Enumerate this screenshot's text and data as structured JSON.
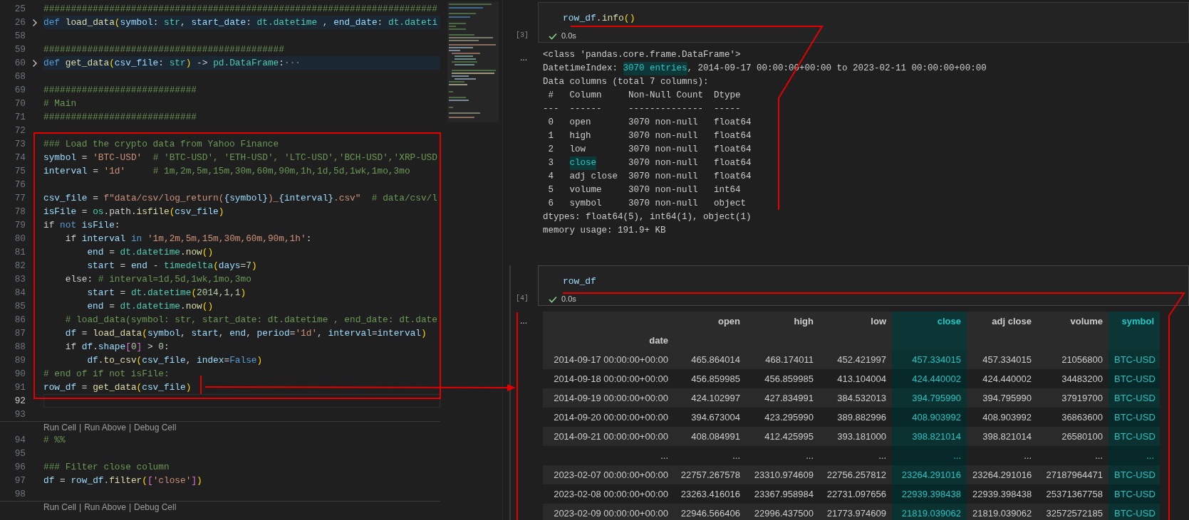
{
  "editor": {
    "lines": [
      {
        "kind": "line",
        "number": "25",
        "segments": [
          {
            "kind": "comment",
            "text": "########################################################################"
          }
        ]
      },
      {
        "kind": "folded",
        "number": "26",
        "segments": [
          {
            "kind": "kw",
            "text": "def "
          },
          {
            "kind": "fn",
            "text": "load_data"
          },
          {
            "kind": "paren",
            "text": "("
          },
          {
            "kind": "var",
            "text": "symbol"
          },
          {
            "kind": "plain",
            "text": ": "
          },
          {
            "kind": "cls",
            "text": "str"
          },
          {
            "kind": "plain",
            "text": ", "
          },
          {
            "kind": "var",
            "text": "start_date"
          },
          {
            "kind": "plain",
            "text": ": "
          },
          {
            "kind": "cls",
            "text": "dt.datetime"
          },
          {
            "kind": "plain",
            "text": " , "
          },
          {
            "kind": "var",
            "text": "end_date"
          },
          {
            "kind": "plain",
            "text": ": "
          },
          {
            "kind": "cls",
            "text": "dt.dateti"
          }
        ]
      },
      {
        "kind": "line",
        "number": "58"
      },
      {
        "kind": "line",
        "number": "59",
        "segments": [
          {
            "kind": "comment",
            "text": "############################################"
          }
        ]
      },
      {
        "kind": "folded",
        "number": "60",
        "segments": [
          {
            "kind": "kw",
            "text": "def "
          },
          {
            "kind": "fn",
            "text": "get_data"
          },
          {
            "kind": "paren",
            "text": "("
          },
          {
            "kind": "var",
            "text": "csv_file"
          },
          {
            "kind": "plain",
            "text": ": "
          },
          {
            "kind": "cls",
            "text": "str"
          },
          {
            "kind": "paren",
            "text": ")"
          },
          {
            "kind": "plain",
            "text": " -> "
          },
          {
            "kind": "cls",
            "text": "pd.DataFrame"
          },
          {
            "kind": "plain",
            "text": ":"
          },
          {
            "kind": "fold",
            "text": "···"
          }
        ]
      },
      {
        "kind": "line",
        "number": "68"
      },
      {
        "kind": "line",
        "number": "69",
        "segments": [
          {
            "kind": "comment",
            "text": "############################"
          }
        ]
      },
      {
        "kind": "line",
        "number": "70",
        "segments": [
          {
            "kind": "comment",
            "text": "# Main"
          }
        ]
      },
      {
        "kind": "line",
        "number": "71",
        "segments": [
          {
            "kind": "comment",
            "text": "############################"
          }
        ]
      },
      {
        "kind": "line",
        "number": "72"
      },
      {
        "kind": "line",
        "number": "73",
        "segments": [
          {
            "kind": "comment",
            "text": "### Load the crypto data from Yahoo Finance"
          }
        ]
      },
      {
        "kind": "line",
        "number": "74",
        "segments": [
          {
            "kind": "var",
            "text": "symbol"
          },
          {
            "kind": "plain",
            "text": " = "
          },
          {
            "kind": "str",
            "text": "'BTC-USD'"
          },
          {
            "kind": "comment",
            "text": "  # 'BTC-USD', 'ETH-USD', 'LTC-USD','BCH-USD','XRP-USD"
          }
        ]
      },
      {
        "kind": "line",
        "number": "75",
        "segments": [
          {
            "kind": "var",
            "text": "interval"
          },
          {
            "kind": "plain",
            "text": " = "
          },
          {
            "kind": "str",
            "text": "'1d'"
          },
          {
            "kind": "comment",
            "text": "     # 1m,2m,5m,15m,30m,60m,90m,1h,1d,5d,1wk,1mo,3mo"
          }
        ]
      },
      {
        "kind": "line",
        "number": "76"
      },
      {
        "kind": "line",
        "number": "77",
        "segments": [
          {
            "kind": "var",
            "text": "csv_file"
          },
          {
            "kind": "plain",
            "text": " = "
          },
          {
            "kind": "str",
            "text": "f\"data/csv/log_return("
          },
          {
            "kind": "var",
            "text": "{symbol}"
          },
          {
            "kind": "str",
            "text": ")_"
          },
          {
            "kind": "var",
            "text": "{interval}"
          },
          {
            "kind": "str",
            "text": ".csv\""
          },
          {
            "kind": "comment",
            "text": "  # data/csv/l"
          }
        ]
      },
      {
        "kind": "line",
        "number": "78",
        "segments": [
          {
            "kind": "var",
            "text": "isFile"
          },
          {
            "kind": "plain",
            "text": " = "
          },
          {
            "kind": "cls",
            "text": "os"
          },
          {
            "kind": "plain",
            "text": ".path."
          },
          {
            "kind": "fn",
            "text": "isfile"
          },
          {
            "kind": "paren",
            "text": "("
          },
          {
            "kind": "var",
            "text": "csv_file"
          },
          {
            "kind": "paren",
            "text": ")"
          }
        ]
      },
      {
        "kind": "line",
        "number": "79",
        "segments": [
          {
            "kind": "plain",
            "text": "if "
          },
          {
            "kind": "kw",
            "text": "not "
          },
          {
            "kind": "var",
            "text": "isFile"
          },
          {
            "kind": "plain",
            "text": ":"
          }
        ]
      },
      {
        "kind": "line",
        "number": "80",
        "segments": [
          {
            "kind": "plain",
            "text": "    if "
          },
          {
            "kind": "var",
            "text": "interval "
          },
          {
            "kind": "kw",
            "text": "in "
          },
          {
            "kind": "str",
            "text": "'1m,2m,5m,15m,30m,60m,90m,1h'"
          },
          {
            "kind": "plain",
            "text": ":"
          }
        ]
      },
      {
        "kind": "line",
        "number": "81",
        "segments": [
          {
            "kind": "var",
            "text": "        end"
          },
          {
            "kind": "plain",
            "text": " = "
          },
          {
            "kind": "cls",
            "text": "dt.datetime"
          },
          {
            "kind": "plain",
            "text": "."
          },
          {
            "kind": "fn",
            "text": "now"
          },
          {
            "kind": "paren",
            "text": "()"
          }
        ]
      },
      {
        "kind": "line",
        "number": "82",
        "segments": [
          {
            "kind": "var",
            "text": "        start"
          },
          {
            "kind": "plain",
            "text": " = "
          },
          {
            "kind": "var",
            "text": "end"
          },
          {
            "kind": "plain",
            "text": " - "
          },
          {
            "kind": "cls",
            "text": "timedelta"
          },
          {
            "kind": "paren",
            "text": "("
          },
          {
            "kind": "var",
            "text": "days"
          },
          {
            "kind": "plain",
            "text": "="
          },
          {
            "kind": "num",
            "text": "7"
          },
          {
            "kind": "paren",
            "text": ")"
          }
        ]
      },
      {
        "kind": "line",
        "number": "83",
        "segments": [
          {
            "kind": "plain",
            "text": "    else: "
          },
          {
            "kind": "comment",
            "text": "# interval=1d,5d,1wk,1mo,3mo"
          }
        ]
      },
      {
        "kind": "line",
        "number": "84",
        "segments": [
          {
            "kind": "var",
            "text": "        start"
          },
          {
            "kind": "plain",
            "text": " = "
          },
          {
            "kind": "cls",
            "text": "dt.datetime"
          },
          {
            "kind": "paren",
            "text": "("
          },
          {
            "kind": "num",
            "text": "2014,1,1"
          },
          {
            "kind": "paren",
            "text": ")"
          }
        ]
      },
      {
        "kind": "line",
        "number": "85",
        "segments": [
          {
            "kind": "var",
            "text": "        end"
          },
          {
            "kind": "plain",
            "text": " = "
          },
          {
            "kind": "cls",
            "text": "dt.datetime"
          },
          {
            "kind": "plain",
            "text": "."
          },
          {
            "kind": "fn",
            "text": "now"
          },
          {
            "kind": "paren",
            "text": "()"
          }
        ]
      },
      {
        "kind": "line",
        "number": "86",
        "segments": [
          {
            "kind": "comment",
            "text": "    # load_data(symbol: str, start_date: dt.datetime , end_date: dt.date"
          }
        ]
      },
      {
        "kind": "line",
        "number": "87",
        "segments": [
          {
            "kind": "var",
            "text": "    df"
          },
          {
            "kind": "plain",
            "text": " = "
          },
          {
            "kind": "fn",
            "text": "load_data"
          },
          {
            "kind": "paren",
            "text": "("
          },
          {
            "kind": "var",
            "text": "symbol"
          },
          {
            "kind": "plain",
            "text": ", "
          },
          {
            "kind": "var",
            "text": "start"
          },
          {
            "kind": "plain",
            "text": ", "
          },
          {
            "kind": "var",
            "text": "end"
          },
          {
            "kind": "plain",
            "text": ", "
          },
          {
            "kind": "var",
            "text": "period"
          },
          {
            "kind": "plain",
            "text": "="
          },
          {
            "kind": "str",
            "text": "'1d'"
          },
          {
            "kind": "plain",
            "text": ", "
          },
          {
            "kind": "var",
            "text": "interval"
          },
          {
            "kind": "plain",
            "text": "="
          },
          {
            "kind": "var",
            "text": "interval"
          },
          {
            "kind": "paren",
            "text": ")"
          }
        ]
      },
      {
        "kind": "line",
        "number": "88",
        "segments": [
          {
            "kind": "plain",
            "text": "    if "
          },
          {
            "kind": "var",
            "text": "df"
          },
          {
            "kind": "plain",
            "text": "."
          },
          {
            "kind": "var",
            "text": "shape"
          },
          {
            "kind": "bracket",
            "text": "["
          },
          {
            "kind": "num",
            "text": "0"
          },
          {
            "kind": "bracket",
            "text": "]"
          },
          {
            "kind": "plain",
            "text": " > "
          },
          {
            "kind": "num",
            "text": "0"
          },
          {
            "kind": "plain",
            "text": ":"
          }
        ]
      },
      {
        "kind": "line",
        "number": "89",
        "segments": [
          {
            "kind": "var",
            "text": "        df"
          },
          {
            "kind": "plain",
            "text": "."
          },
          {
            "kind": "fn",
            "text": "to_csv"
          },
          {
            "kind": "paren",
            "text": "("
          },
          {
            "kind": "var",
            "text": "csv_file"
          },
          {
            "kind": "plain",
            "text": ", "
          },
          {
            "kind": "var",
            "text": "index"
          },
          {
            "kind": "plain",
            "text": "="
          },
          {
            "kind": "kw",
            "text": "False"
          },
          {
            "kind": "paren",
            "text": ")"
          }
        ]
      },
      {
        "kind": "line",
        "number": "90",
        "segments": [
          {
            "kind": "comment",
            "text": "# end of if not isFile:"
          }
        ]
      },
      {
        "kind": "line",
        "number": "91",
        "segments": [
          {
            "kind": "var",
            "text": "row_df"
          },
          {
            "kind": "plain",
            "text": " = "
          },
          {
            "kind": "fn",
            "text": "get_data"
          },
          {
            "kind": "paren",
            "text": "("
          },
          {
            "kind": "var",
            "text": "csv_file"
          },
          {
            "kind": "paren",
            "text": ")"
          }
        ]
      },
      {
        "kind": "current",
        "number": "92"
      },
      {
        "kind": "line",
        "number": "93"
      },
      {
        "kind": "codelens",
        "links": [
          "Run Cell",
          "Run Above",
          "Debug Cell"
        ],
        "separator": "|"
      },
      {
        "kind": "line",
        "number": "94",
        "segments": [
          {
            "kind": "comment",
            "text": "# %%"
          }
        ]
      },
      {
        "kind": "line",
        "number": "95"
      },
      {
        "kind": "line",
        "number": "96",
        "segments": [
          {
            "kind": "comment",
            "text": "### Filter close column"
          }
        ]
      },
      {
        "kind": "line",
        "number": "97",
        "segments": [
          {
            "kind": "var",
            "text": "df"
          },
          {
            "kind": "plain",
            "text": " = "
          },
          {
            "kind": "var",
            "text": "row_df"
          },
          {
            "kind": "plain",
            "text": "."
          },
          {
            "kind": "fn",
            "text": "filter"
          },
          {
            "kind": "paren",
            "text": "("
          },
          {
            "kind": "bracket",
            "text": "["
          },
          {
            "kind": "str",
            "text": "'close'"
          },
          {
            "kind": "bracket",
            "text": "]"
          },
          {
            "kind": "paren",
            "text": ")"
          }
        ]
      },
      {
        "kind": "line",
        "number": "98"
      },
      {
        "kind": "codelens",
        "links": [
          "Run Cell",
          "Run Above",
          "Debug Cell"
        ],
        "separator": "|"
      }
    ]
  },
  "notebook": {
    "cells": [
      {
        "selected": false,
        "execution_count": "[3]",
        "status": "0.0s",
        "output_menu": "...",
        "code": [
          {
            "kind": "var",
            "text": "row_df"
          },
          {
            "kind": "plain",
            "text": "."
          },
          {
            "kind": "fn",
            "text": "info"
          },
          {
            "kind": "paren",
            "text": "()"
          }
        ],
        "output": {
          "kind": "text",
          "lines": [
            [
              {
                "text": "<class 'pandas.core.frame.DataFrame'>",
                "highlighted": false
              }
            ],
            [
              {
                "text": "DatetimeIndex: ",
                "highlighted": false
              },
              {
                "text": "3070 entries",
                "highlighted": true
              },
              {
                "text": ", 2014-09-17 00:00:00+00:00 to 2023-02-11 00:00:00+00:00",
                "highlighted": false
              }
            ],
            [
              {
                "text": "Data columns (total 7 columns):",
                "highlighted": false
              }
            ],
            [
              {
                "text": " #   Column     Non-Null Count  Dtype",
                "highlighted": false
              }
            ],
            [
              {
                "text": "---  ------     --------------  -----",
                "highlighted": false
              }
            ],
            [
              {
                "text": " 0   open       3070 non-null   float64",
                "highlighted": false
              }
            ],
            [
              {
                "text": " 1   high       3070 non-null   float64",
                "highlighted": false
              }
            ],
            [
              {
                "text": " 2   low        3070 non-null   float64",
                "highlighted": false
              }
            ],
            [
              {
                "text": " 3   ",
                "highlighted": false
              },
              {
                "text": "close",
                "highlighted": true
              },
              {
                "text": "      3070 non-null   float64",
                "highlighted": false
              }
            ],
            [
              {
                "text": " 4   adj close  3070 non-null   float64",
                "highlighted": false
              }
            ],
            [
              {
                "text": " 5   volume     3070 non-null   int64",
                "highlighted": false
              }
            ],
            [
              {
                "text": " 6   symbol     3070 non-null   object",
                "highlighted": false
              }
            ],
            [
              {
                "text": "dtypes: float64(5), int64(1), object(1)",
                "highlighted": false
              }
            ],
            [
              {
                "text": "memory usage: 191.9+ KB",
                "highlighted": false
              }
            ]
          ]
        }
      },
      {
        "selected": true,
        "execution_count": "[4]",
        "status": "0.0s",
        "output_menu": "...",
        "code": [
          {
            "kind": "var",
            "text": "row_df"
          }
        ],
        "output": {
          "kind": "table",
          "index_name": "date",
          "columns": [
            {
              "label": "open",
              "highlighted": false
            },
            {
              "label": "high",
              "highlighted": false
            },
            {
              "label": "low",
              "highlighted": false
            },
            {
              "label": "close",
              "highlighted": true
            },
            {
              "label": "adj close",
              "highlighted": false
            },
            {
              "label": "volume",
              "highlighted": false
            },
            {
              "label": "symbol",
              "highlighted": true
            }
          ],
          "rows": [
            {
              "index": "2014-09-17 00:00:00+00:00",
              "cells": [
                "465.864014",
                "468.174011",
                "452.421997",
                "457.334015",
                "457.334015",
                "21056800",
                "BTC-USD"
              ]
            },
            {
              "index": "2014-09-18 00:00:00+00:00",
              "cells": [
                "456.859985",
                "456.859985",
                "413.104004",
                "424.440002",
                "424.440002",
                "34483200",
                "BTC-USD"
              ]
            },
            {
              "index": "2014-09-19 00:00:00+00:00",
              "cells": [
                "424.102997",
                "427.834991",
                "384.532013",
                "394.795990",
                "394.795990",
                "37919700",
                "BTC-USD"
              ]
            },
            {
              "index": "2014-09-20 00:00:00+00:00",
              "cells": [
                "394.673004",
                "423.295990",
                "389.882996",
                "408.903992",
                "408.903992",
                "36863600",
                "BTC-USD"
              ]
            },
            {
              "index": "2014-09-21 00:00:00+00:00",
              "cells": [
                "408.084991",
                "412.425995",
                "393.181000",
                "398.821014",
                "398.821014",
                "26580100",
                "BTC-USD"
              ]
            },
            {
              "index": "...",
              "cells": [
                "...",
                "...",
                "...",
                "...",
                "...",
                "...",
                "..."
              ]
            },
            {
              "index": "2023-02-07 00:00:00+00:00",
              "cells": [
                "22757.267578",
                "23310.974609",
                "22756.257812",
                "23264.291016",
                "23264.291016",
                "27187964471",
                "BTC-USD"
              ]
            },
            {
              "index": "2023-02-08 00:00:00+00:00",
              "cells": [
                "23263.416016",
                "23367.958984",
                "22731.097656",
                "22939.398438",
                "22939.398438",
                "25371367758",
                "BTC-USD"
              ]
            },
            {
              "index": "2023-02-09 00:00:00+00:00",
              "cells": [
                "22946.566406",
                "22996.437500",
                "21773.974609",
                "21819.039062",
                "21819.039062",
                "32572572185",
                "BTC-USD"
              ]
            }
          ]
        }
      }
    ]
  }
}
